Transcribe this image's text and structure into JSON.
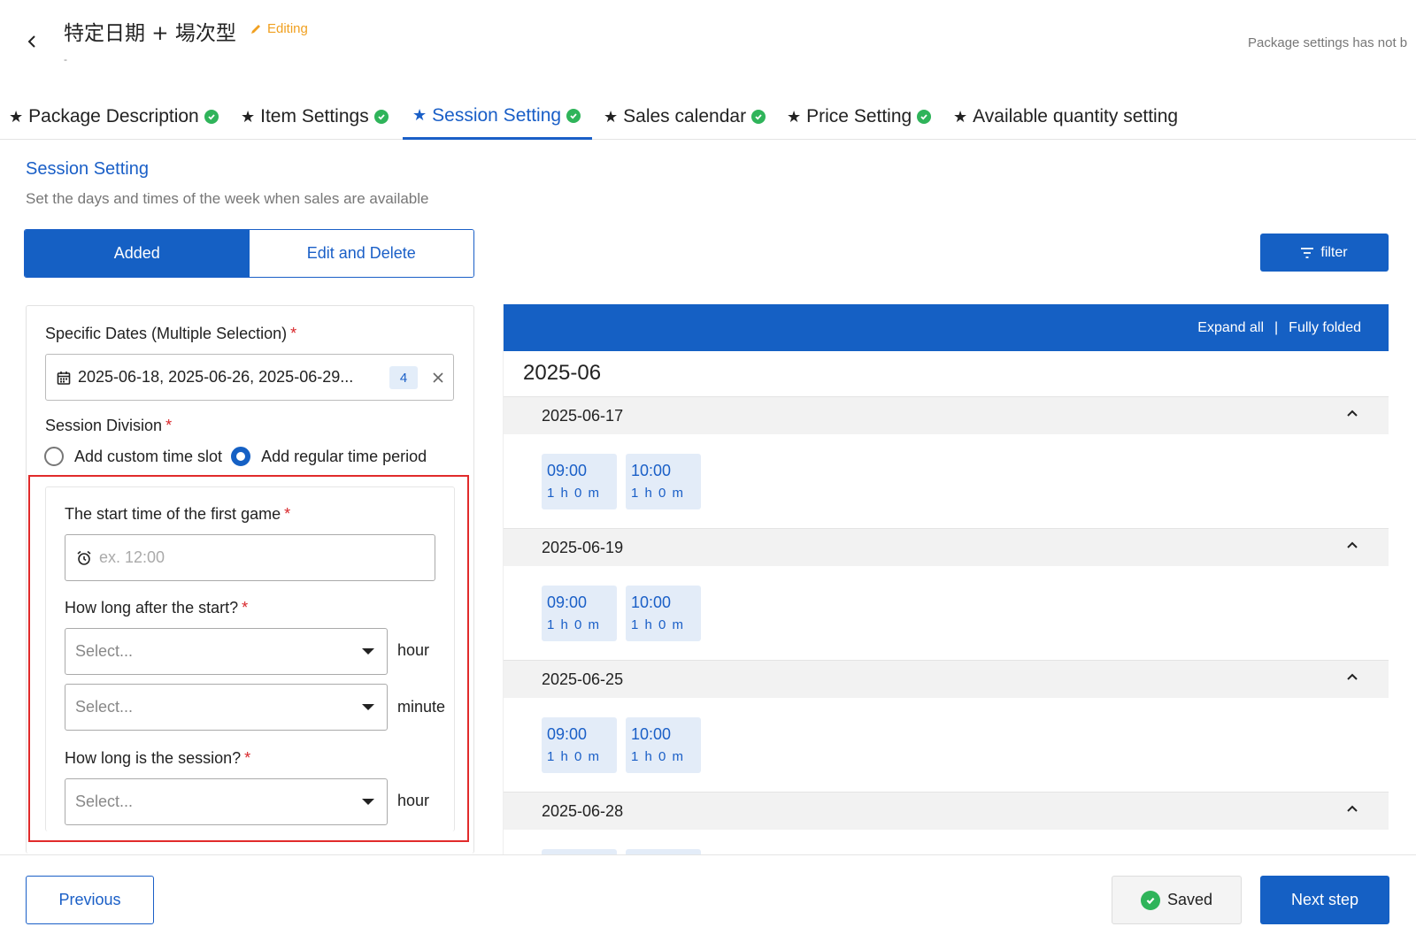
{
  "header": {
    "title": "特定日期 + 場次型",
    "editing_label": "Editing",
    "subtitle": "-",
    "status": "Package settings has not b"
  },
  "tabs": [
    {
      "label": "Package Description",
      "complete": true
    },
    {
      "label": "Item Settings",
      "complete": true
    },
    {
      "label": "Session Setting",
      "complete": true,
      "active": true
    },
    {
      "label": "Sales calendar",
      "complete": true
    },
    {
      "label": "Price Setting",
      "complete": true
    },
    {
      "label": "Available quantity setting",
      "complete": false
    }
  ],
  "section": {
    "title": "Session Setting",
    "description": "Set the days and times of the week when sales are available"
  },
  "mode_toggle": {
    "added": "Added",
    "edit_delete": "Edit and Delete",
    "selected": "added"
  },
  "filter_label": "filter",
  "form": {
    "dates_label": "Specific Dates (Multiple Selection)",
    "dates_value": "2025-06-18, 2025-06-26, 2025-06-29...",
    "dates_count": "4",
    "division_label": "Session Division",
    "option_custom": "Add custom time slot",
    "option_regular": "Add regular time period",
    "selected_option": "regular",
    "start_label": "The start time of the first game",
    "start_placeholder": "ex. 12:00",
    "after_label": "How long after the start?",
    "select_placeholder": "Select...",
    "unit_hour": "hour",
    "unit_minute": "minute",
    "duration_label": "How long is the session?"
  },
  "calendar": {
    "expand_all": "Expand all",
    "separator": "|",
    "fully_folded": "Fully folded",
    "month": "2025-06",
    "days": [
      {
        "date": "2025-06-17",
        "slots": [
          {
            "time": "09:00",
            "dur": "1 h 0 m"
          },
          {
            "time": "10:00",
            "dur": "1 h 0 m"
          }
        ]
      },
      {
        "date": "2025-06-19",
        "slots": [
          {
            "time": "09:00",
            "dur": "1 h 0 m"
          },
          {
            "time": "10:00",
            "dur": "1 h 0 m"
          }
        ]
      },
      {
        "date": "2025-06-25",
        "slots": [
          {
            "time": "09:00",
            "dur": "1 h 0 m"
          },
          {
            "time": "10:00",
            "dur": "1 h 0 m"
          }
        ]
      },
      {
        "date": "2025-06-28",
        "slots": [
          {
            "time": "",
            "dur": ""
          },
          {
            "time": "",
            "dur": ""
          }
        ]
      }
    ]
  },
  "footer": {
    "previous": "Previous",
    "saved": "Saved",
    "next": "Next step"
  },
  "colors": {
    "primary": "#1560c4",
    "success": "#2fb45a",
    "warning": "#f0a020",
    "required": "#d8262a",
    "highlight_box": "#e12b2b"
  }
}
